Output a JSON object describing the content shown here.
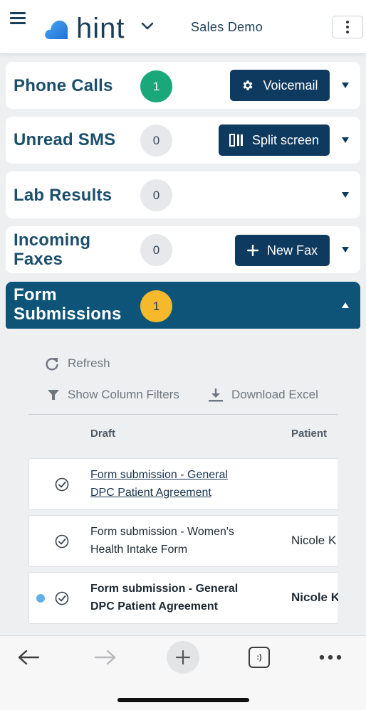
{
  "header": {
    "logo_text": "hint",
    "account_name": "Sales Demo"
  },
  "sections": {
    "phone_calls": {
      "title": "Phone Calls",
      "count": "1",
      "action_label": "Voicemail"
    },
    "unread_sms": {
      "title": "Unread SMS",
      "count": "0",
      "action_label": "Split screen"
    },
    "lab_results": {
      "title": "Lab Results",
      "count": "0"
    },
    "incoming_faxes": {
      "title_line1": "Incoming",
      "title_line2": "Faxes",
      "count": "0",
      "action_label": "New Fax"
    },
    "form_submissions": {
      "title_line1": "Form",
      "title_line2": "Submissions",
      "count": "1"
    }
  },
  "toolbar": {
    "refresh_label": "Refresh",
    "filters_label": "Show Column Filters",
    "download_label": "Download Excel"
  },
  "table": {
    "columns": [
      "Draft",
      "Patient"
    ],
    "rows": [
      {
        "line1": "Form submission - General",
        "line2": "DPC Patient Agreement",
        "patient": "",
        "unread": false,
        "style": "link"
      },
      {
        "line1": "Form submission - Women's",
        "line2": "Health Intake Form",
        "patient": "Nicole K",
        "unread": false,
        "style": "normal"
      },
      {
        "line1": "Form submission - General",
        "line2": "DPC Patient Agreement",
        "patient": "Nicole K",
        "unread": true,
        "style": "bold"
      }
    ]
  },
  "colors": {
    "brand_navy": "#0f3a5f",
    "active_section": "#0d5478",
    "badge_green": "#1aa87a",
    "badge_yellow": "#f5b92b",
    "unread_dot": "#62aee9"
  },
  "bottom_nav": {
    "icons": [
      "back-arrow-icon",
      "forward-arrow-icon",
      "plus-icon",
      "tabs-icon",
      "more-icon"
    ],
    "tabs_label": ":)"
  }
}
